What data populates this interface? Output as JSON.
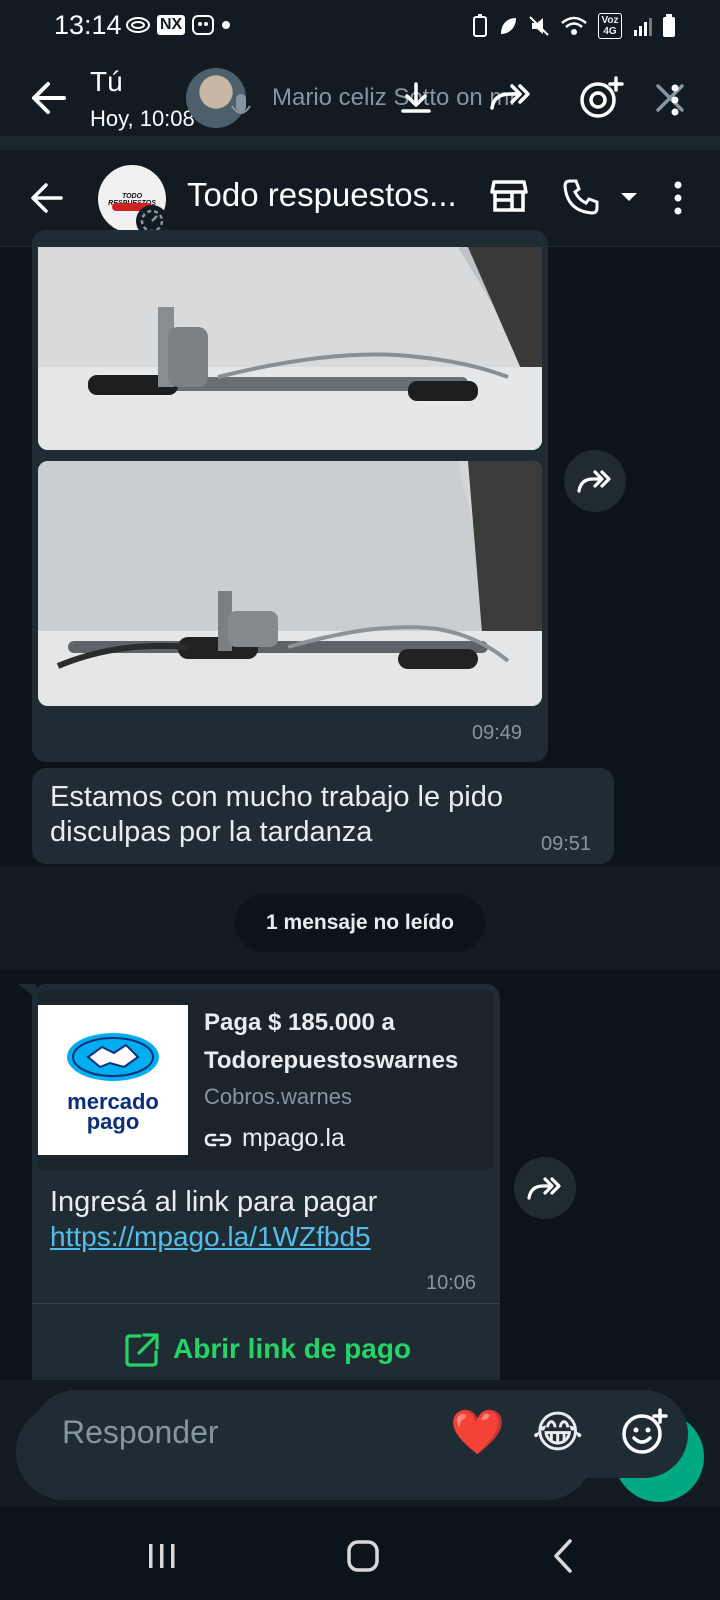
{
  "status_bar": {
    "time": "13:14",
    "left_badge": "NX",
    "network": "Voz 4G"
  },
  "status_viewer": {
    "user": "Tú",
    "time": "Hoy, 10:08",
    "caption": "Mario celiz Sotto on mr"
  },
  "chat": {
    "title": "Todo respuestos...",
    "avatar_text": "TODO RESPUESTOS"
  },
  "messages": {
    "photos_time": "09:49",
    "apology_text": "Estamos con mucho trabajo le pido disculpas por la tardanza",
    "apology_time": "09:51",
    "unread": "1 mensaje no leído",
    "payment": {
      "title": "Paga $ 185.000 a Todorepuestoswarnes",
      "subtitle": "Cobros.warnes",
      "domain": "mpago.la",
      "logo_line1": "mercado",
      "logo_line2": "pago",
      "body": "Ingresá al link para pagar",
      "link": "https://mpago.la/1WZfbd5",
      "time": "10:06",
      "action": "Abrir link de pago"
    }
  },
  "reply": {
    "placeholder": "Responder",
    "reactions": [
      "❤️",
      "😂"
    ]
  },
  "colors": {
    "background": "#0b141a",
    "bubble": "#202c33",
    "accent_green": "#25d366",
    "link_blue": "#53bdeb"
  }
}
